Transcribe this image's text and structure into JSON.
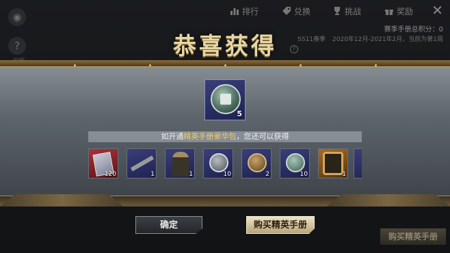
{
  "topbar": {
    "tabs": [
      {
        "label": "排行",
        "icon": "ranking-icon"
      },
      {
        "label": "兑换",
        "icon": "tag-icon"
      },
      {
        "label": "挑战",
        "icon": "trophy-icon"
      },
      {
        "label": "奖励",
        "icon": "gift-icon"
      }
    ],
    "left_label": "说明"
  },
  "season": {
    "score_label": "赛季手册总积分：",
    "score_value": "0",
    "season_name": "SS11赛季",
    "date_range": "2020年12月-2021年2月，当前为第1周"
  },
  "dialog": {
    "title": "恭喜获得",
    "main_reward": {
      "name": "medal-coin-icon",
      "quantity": "5",
      "rarity": "purple"
    },
    "info_prefix": "如开通",
    "info_highlight": "精英手册豪华包",
    "info_suffix": "，您还可以获得",
    "bonus_items": [
      {
        "name": "card-pack-icon",
        "quantity": "120",
        "rarity": "red"
      },
      {
        "name": "rifle-icon",
        "quantity": "1",
        "rarity": "purple"
      },
      {
        "name": "character-outfit-icon",
        "quantity": "1",
        "rarity": "purple"
      },
      {
        "name": "silver-coin-icon",
        "quantity": "10",
        "rarity": "purple"
      },
      {
        "name": "bronze-token-icon",
        "quantity": "2",
        "rarity": "purple"
      },
      {
        "name": "medal-coin-icon",
        "quantity": "10",
        "rarity": "purple"
      },
      {
        "name": "avatar-frame-icon",
        "quantity": "1",
        "rarity": "orange"
      }
    ],
    "confirm_label": "确定",
    "buy_label": "购买精英手册"
  },
  "background_buy_label": "购买精英手册",
  "colors": {
    "highlight": "#f4cf5a",
    "title": "#e7d6a6",
    "rarity_purple": "#2b3066",
    "rarity_red": "#8a2228",
    "rarity_orange": "#8a5320"
  }
}
